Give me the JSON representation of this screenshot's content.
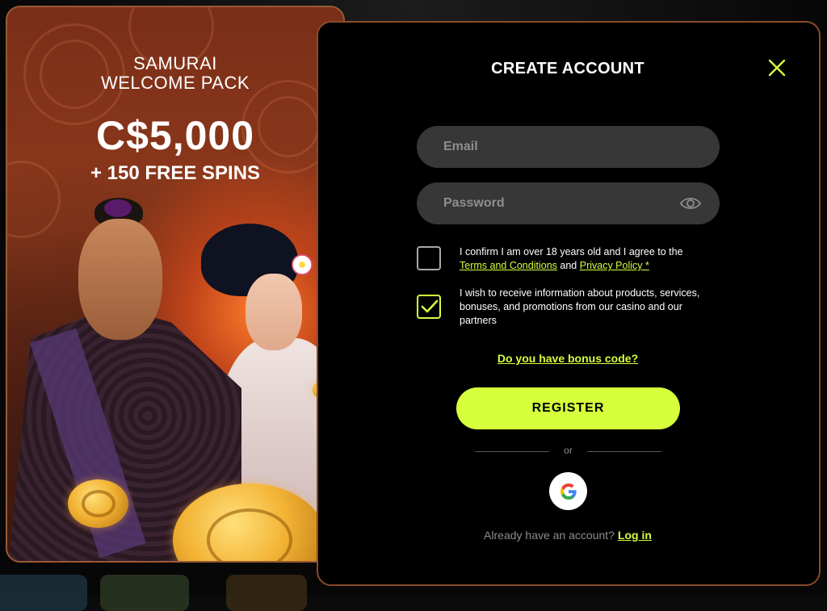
{
  "promo": {
    "title_line1": "SAMURAI",
    "title_line2": "WELCOME PACK",
    "amount": "C$5,000",
    "spins": "+ 150 FREE SPINS",
    "illustration": "samurai-and-geisha-with-gold-coins"
  },
  "form": {
    "title": "CREATE ACCOUNT",
    "close_icon": "close-icon",
    "email_placeholder": "Email",
    "password_placeholder": "Password",
    "password_toggle_icon": "eye-icon",
    "consent_age": {
      "checked": false,
      "text_prefix": "I confirm I am over 18 years old and I agree to the",
      "terms_link": "Terms and Conditions",
      "and": "and",
      "privacy_link": "Privacy Policy *"
    },
    "consent_marketing": {
      "checked": true,
      "text": "I wish to receive information about products, services, bonuses, and promotions from our casino and our partners"
    },
    "bonus_code_link": "Do you have bonus code?",
    "register_label": "REGISTER",
    "or_label": "or",
    "google_icon": "google-icon",
    "login_prompt": "Already have an account?",
    "login_link": "Log in"
  },
  "colors": {
    "accent": "#d6ff3c",
    "field_bg": "#373737",
    "panel_bg": "#000000",
    "panel_border": "#8a4b2a"
  }
}
